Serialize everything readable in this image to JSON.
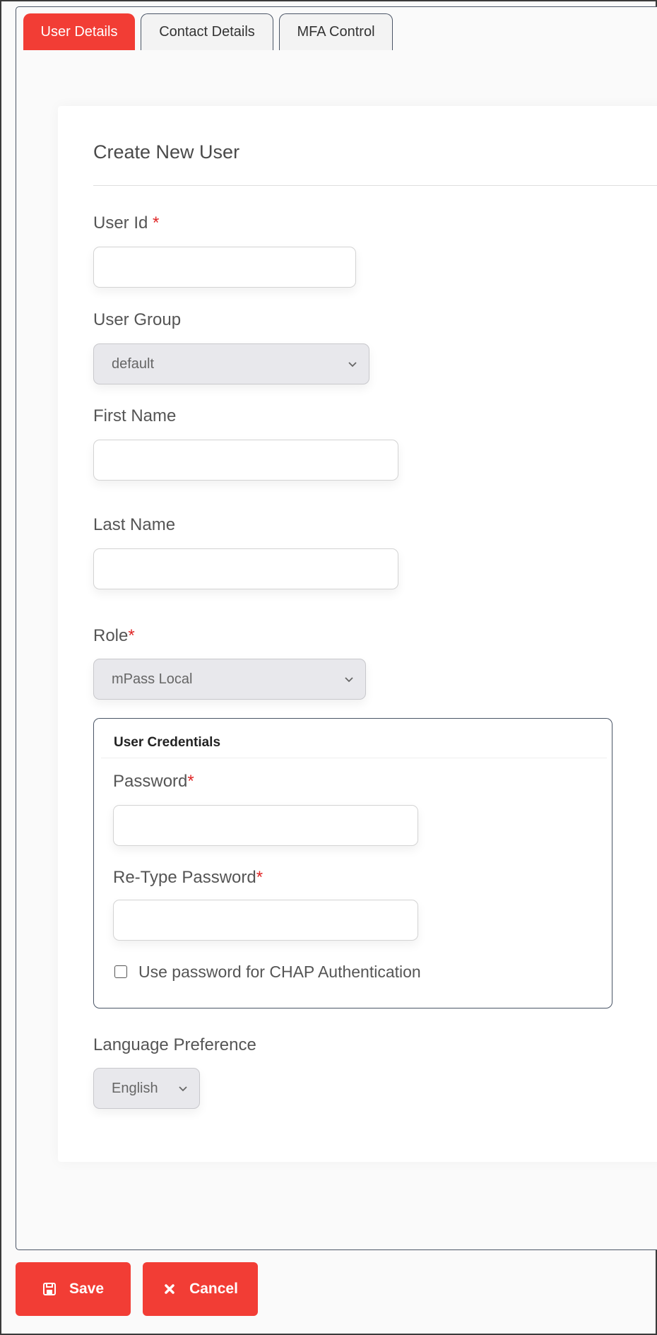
{
  "tabs": [
    {
      "label": "User Details",
      "active": true
    },
    {
      "label": "Contact Details",
      "active": false
    },
    {
      "label": "MFA Control",
      "active": false
    }
  ],
  "form": {
    "title": "Create New User",
    "user_id": {
      "label": "User Id",
      "required_mark": "*",
      "value": ""
    },
    "user_group": {
      "label": "User Group",
      "value": "default"
    },
    "first_name": {
      "label": "First Name",
      "value": ""
    },
    "last_name": {
      "label": "Last Name",
      "value": ""
    },
    "role": {
      "label": "Role",
      "required_mark": "*",
      "value": "mPass Local"
    },
    "credentials": {
      "title": "User Credentials",
      "password": {
        "label": "Password",
        "required_mark": "*",
        "value": ""
      },
      "retype_password": {
        "label": "Re-Type Password",
        "required_mark": "*",
        "value": ""
      },
      "chap": {
        "label": "Use password for CHAP Authentication",
        "checked": false
      }
    },
    "language": {
      "label": "Language Preference",
      "value": "English"
    }
  },
  "buttons": {
    "save": {
      "label": "Save",
      "icon": "save-icon"
    },
    "cancel": {
      "label": "Cancel",
      "icon": "close-icon"
    }
  },
  "colors": {
    "accent": "#f23d35",
    "border": "#4a5566",
    "required": "#e02727"
  }
}
